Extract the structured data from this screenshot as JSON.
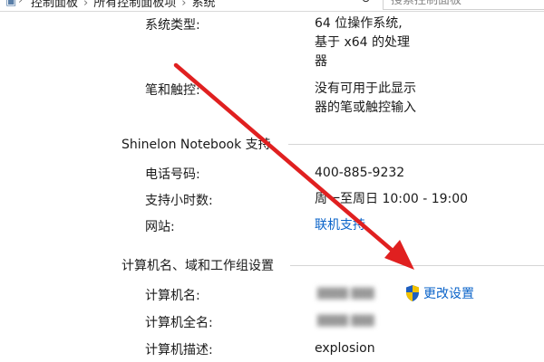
{
  "address_bar": {
    "breadcrumb": [
      "控制面板",
      "所有控制面板项",
      "系统"
    ],
    "search_placeholder": "搜索控制面板"
  },
  "system": {
    "type_label": "系统类型:",
    "type_value_lines": [
      "64 位操作系统,",
      "基于 x64 的处理",
      "器"
    ],
    "pen_label": "笔和触控:",
    "pen_value_lines": [
      "没有可用于此显示",
      "器的笔或触控输入"
    ]
  },
  "support": {
    "title": "Shinelon Notebook 支持",
    "phone_label": "电话号码:",
    "phone_value": "400-885-9232",
    "hours_label": "支持小时数:",
    "hours_value": "周一至周日 10:00 - 19:00",
    "website_label": "网站:",
    "website_value": "联机支持"
  },
  "computer": {
    "title": "计算机名、域和工作组设置",
    "name_label": "计算机名:",
    "fullname_label": "计算机全名:",
    "description_label": "计算机描述:",
    "description_value": "explosion",
    "change_settings_label": "更改设置"
  },
  "colors": {
    "link": "#0a63c9",
    "annotation_arrow": "#e02020",
    "shield_blue": "#1f5fbf",
    "shield_yellow": "#f2c200"
  }
}
